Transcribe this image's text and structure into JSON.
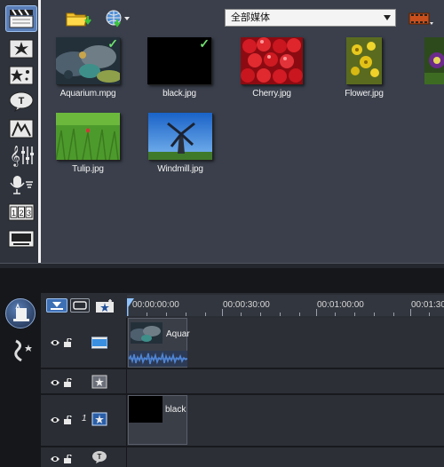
{
  "library": {
    "media_filter": "全部媒体",
    "items": [
      {
        "name": "Aquarium.mpg",
        "checked": true
      },
      {
        "name": "black.jpg",
        "checked": true
      },
      {
        "name": "Cherry.jpg",
        "checked": false
      },
      {
        "name": "Flower.jpg",
        "checked": false
      },
      {
        "name": "Tulip.jpg",
        "checked": false
      },
      {
        "name": "Windmill.jpg",
        "checked": false
      }
    ]
  },
  "left_toolbar": {
    "icons": [
      "video-clapper-icon",
      "transition-icon",
      "effect-filter-icon",
      "title-icon",
      "graphic-icon",
      "audio-mixer-icon",
      "voiceover-icon",
      "chapter-counter-icon",
      "subtitle-icon"
    ]
  },
  "timeline": {
    "ruler": [
      "00:00:00:00",
      "00:00:30:00",
      "00:01:00:00",
      "00:01:30"
    ],
    "clips": {
      "video": "Aquar",
      "overlay": "black"
    },
    "overlay_track_number": "1"
  },
  "colors": {
    "accent": "#5a7fb8",
    "waveform": "#4f86d6",
    "check": "#6fe06f"
  }
}
